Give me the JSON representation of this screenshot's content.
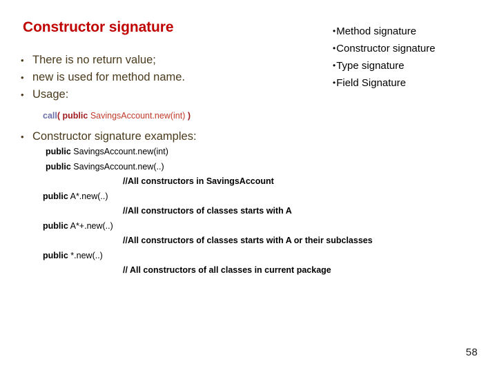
{
  "slide": {
    "title": "Constructor signature",
    "page_number": "58",
    "colors": {
      "title": "#c00000",
      "bullet_text": "#4a3a1c",
      "call_keyword": "#6a6fa8",
      "call_paren": "#9e1b20",
      "call_modifier": "#9e1b20",
      "call_signature": "#c0392b",
      "body_text": "#000000",
      "background": "#ffffff"
    }
  },
  "left_column": {
    "bullets": [
      {
        "marker": "•",
        "text": "There is no return value;"
      },
      {
        "marker": "•",
        "text": "new is used for method name."
      },
      {
        "marker": "•",
        "text": "Usage:"
      }
    ],
    "usage_call": {
      "keyword": "call",
      "open_paren": "(",
      "modifier": "public",
      "signature": "SavingsAccount.new(int)",
      "close_paren": ")"
    },
    "examples_heading": {
      "marker": "•",
      "text": "Constructor signature examples:"
    },
    "examples": [
      {
        "kind": "code",
        "modifier": "public",
        "signature": "SavingsAccount.new(int)",
        "indent": "a"
      },
      {
        "kind": "code",
        "modifier": "public",
        "signature": "SavingsAccount.new(..)",
        "indent": "a"
      },
      {
        "kind": "comment",
        "text": "//All constructors in SavingsAccount",
        "indent": "c"
      },
      {
        "kind": "code",
        "modifier": "public",
        "signature": "A*.new(..)",
        "indent": "b"
      },
      {
        "kind": "comment",
        "text": "//All constructors of classes starts with A",
        "indent": "c"
      },
      {
        "kind": "code",
        "modifier": "public",
        "signature": "A*+.new(..)",
        "indent": "b"
      },
      {
        "kind": "comment",
        "text": "//All constructors of classes starts with A or their subclasses",
        "indent": "c"
      },
      {
        "kind": "code",
        "modifier": "public",
        "signature": "*.new(..)",
        "indent": "b"
      },
      {
        "kind": "comment",
        "text": "// All constructors of all classes in current package",
        "indent": "c"
      }
    ]
  },
  "right_column": {
    "items": [
      {
        "marker": "•",
        "text": "Method signature"
      },
      {
        "marker": "•",
        "text": "Constructor signature"
      },
      {
        "marker": "•",
        "text": "Type signature"
      },
      {
        "marker": "•",
        "text": "Field Signature"
      }
    ]
  }
}
